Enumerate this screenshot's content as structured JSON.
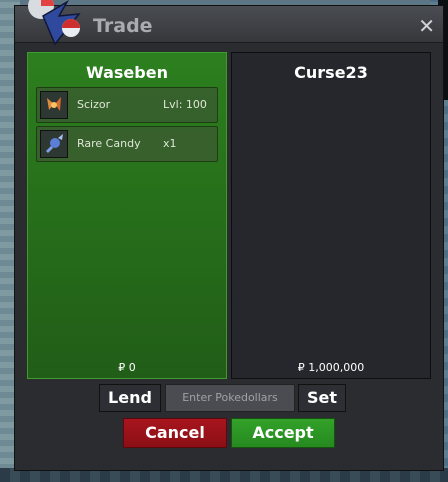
{
  "window": {
    "title": "Trade",
    "close_label": "✕"
  },
  "left_panel": {
    "name": "Waseben",
    "items": [
      {
        "name": "Scizor",
        "extra": "Lvl: 100",
        "icon": "scizor-icon"
      },
      {
        "name": "Rare Candy",
        "extra": "x1",
        "icon": "rare-candy-icon"
      }
    ],
    "money": "₽ 0"
  },
  "right_panel": {
    "name": "Curse23",
    "money": "₽ 1,000,000"
  },
  "controls": {
    "lend_label": "Lend",
    "pokedollars_placeholder": "Enter Pokedollars",
    "set_label": "Set",
    "cancel_label": "Cancel",
    "accept_label": "Accept"
  },
  "colors": {
    "left_panel_green": "#2c7f1e",
    "cancel_red": "#a8151d",
    "accept_green": "#33a12a"
  }
}
